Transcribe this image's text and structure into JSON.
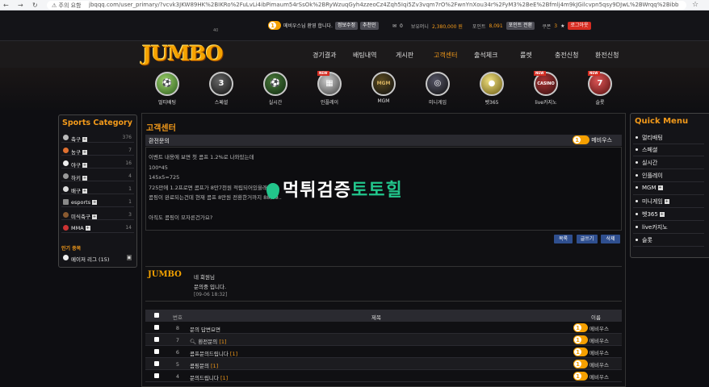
{
  "browser": {
    "warning": "⚠ 주의 요함",
    "url": "jbqqq.com/user_primary/?vcvk3JKW89HK%2BIKRo%2FuLvLi4ibPimaum54rSsOk%2BRyWzuqGyh4zzeoCz4Zqh5Iqi5Zv3vqm7rO%2FwnYnXou34r%2FyM3%2BeE%2Bfmlj4m9kJGilcvpn5qsy9DJwL%2BWrqq%2Bibb4gv%2Fg%2FeWm74rlxu..."
  },
  "top": {
    "level": "1",
    "greeting": "메비우스님 환영 합니다.",
    "btn_info": "정보수정",
    "btn_recommend": "추천인",
    "msg_count": "0",
    "money_label": "보유머니",
    "money": "2,380,000 원",
    "point_label": "포인트",
    "point": "8,091",
    "point_btn": "포인트 전환",
    "coupon_label": "쿠폰",
    "coupon": "3",
    "logout": "로그아웃",
    "small_num": "40"
  },
  "logo": "JUMBO",
  "menu": [
    "경기결과",
    "배팅내역",
    "게시판",
    "고객센터",
    "출석체크",
    "룰렛",
    "충전신청",
    "환전신청"
  ],
  "games": [
    {
      "label": "멀티배팅",
      "glyph": "⚽",
      "isnew": false
    },
    {
      "label": "스페셜",
      "glyph": "3",
      "isnew": false
    },
    {
      "label": "실시간",
      "glyph": "⚽",
      "isnew": false
    },
    {
      "label": "인플레이",
      "glyph": "▦",
      "isnew": true
    },
    {
      "label": "MGM",
      "glyph": "MGM",
      "isnew": false
    },
    {
      "label": "미니게임",
      "glyph": "◎",
      "isnew": false
    },
    {
      "label": "벳365",
      "glyph": "●",
      "isnew": false
    },
    {
      "label": "live카지노",
      "glyph": "CASINO",
      "isnew": true
    },
    {
      "label": "슬롯",
      "glyph": "7",
      "isnew": true
    }
  ],
  "new_tag": "NEW",
  "sports": {
    "title": "Sports Category",
    "items": [
      {
        "name": "축구",
        "count": "376"
      },
      {
        "name": "농구",
        "count": "7"
      },
      {
        "name": "야구",
        "count": "16"
      },
      {
        "name": "하키",
        "count": "4"
      },
      {
        "name": "배구",
        "count": "1"
      },
      {
        "name": "esports",
        "count": "1"
      },
      {
        "name": "미식축구",
        "count": "3"
      },
      {
        "name": "MMA",
        "count": "14"
      }
    ],
    "popular_label": "인기 종목",
    "popular_item": "메이저 리그 (15)"
  },
  "quick": {
    "title": "Quick Menu",
    "items": [
      "멀티배팅",
      "스페셜",
      "실시간",
      "인플레이",
      "MGM",
      "미니게임",
      "벳365",
      "live카지노",
      "슬롯"
    ]
  },
  "main": {
    "title": "고객센터",
    "question_title": "환전문의",
    "author": "메비우스",
    "body": [
      "이벤트 내용에 보면 첫 콤프 1.2%로 나와있는데",
      "100*45",
      "145x5=725",
      "725만에 1.2프로면 콤프가 8만7천원 적립되어있을래",
      "콤핑이 완료되는건데 현재 콤프 8만원 전환한거까지 88,09..",
      "",
      "아직도 콤핑이 모자른건가요?"
    ],
    "btn_list": "목록",
    "btn_write": "글쓰기",
    "btn_delete": "삭제",
    "reply_logo": "JUMBO",
    "reply_line1": "네 회원님",
    "reply_line2": "문의중 입니다.",
    "reply_time": "[09-06 18:32]",
    "table_headers": {
      "no": "번호",
      "subject": "제목",
      "name": "이름"
    },
    "rows": [
      {
        "no": "8",
        "subject": "문의 답변요면",
        "comments": "",
        "name": "메비우스",
        "search": false
      },
      {
        "no": "7",
        "subject": "환전문의",
        "comments": "[1]",
        "name": "메비우스",
        "search": true
      },
      {
        "no": "6",
        "subject": "콤프문의드립니다",
        "comments": "[1]",
        "name": "메비우스",
        "search": false
      },
      {
        "no": "5",
        "subject": "콤핑문의",
        "comments": "[1]",
        "name": "메비우스",
        "search": false
      },
      {
        "no": "4",
        "subject": "문의드립니다",
        "comments": "[1]",
        "name": "메비우스",
        "search": false
      }
    ]
  },
  "watermark": {
    "part1": "먹튀검증",
    "part2": "토토힐"
  },
  "colors": {
    "accent": "#f39a1a",
    "level": "#f5a000",
    "logout": "#d62d22",
    "button": "#2f4f8f"
  }
}
